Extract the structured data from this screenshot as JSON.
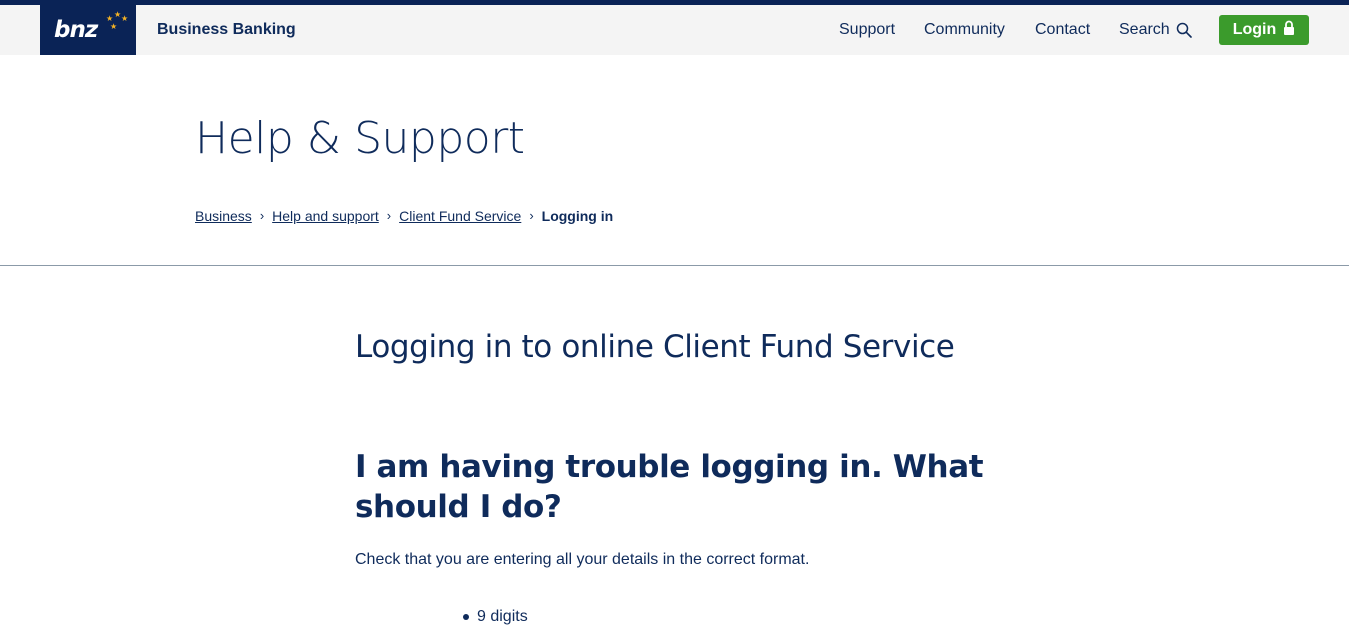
{
  "header": {
    "logo_text": "bnz",
    "brand_title": "Business Banking",
    "nav": {
      "support": "Support",
      "community": "Community",
      "contact": "Contact",
      "search": "Search"
    },
    "login_label": "Login",
    "icons": {
      "search": "search-icon",
      "login": "lock-icon",
      "logo": "stars-icon"
    }
  },
  "page": {
    "title": "Help & Support",
    "breadcrumb": {
      "items": [
        "Business",
        "Help and support",
        "Client Fund Service"
      ],
      "current": "Logging in",
      "separator": "›"
    }
  },
  "article": {
    "title": "Logging in to online Client Fund Service",
    "question": "I am having trouble logging in. What should I do?",
    "body": "Check that you are entering all your details in the correct format.",
    "list": [
      "9 digits"
    ]
  },
  "colors": {
    "navy": "#0a2356",
    "text": "#0f2b5b",
    "login_green": "#3b9b2c",
    "star": "#f5b324",
    "header_bg": "#f4f4f4"
  }
}
